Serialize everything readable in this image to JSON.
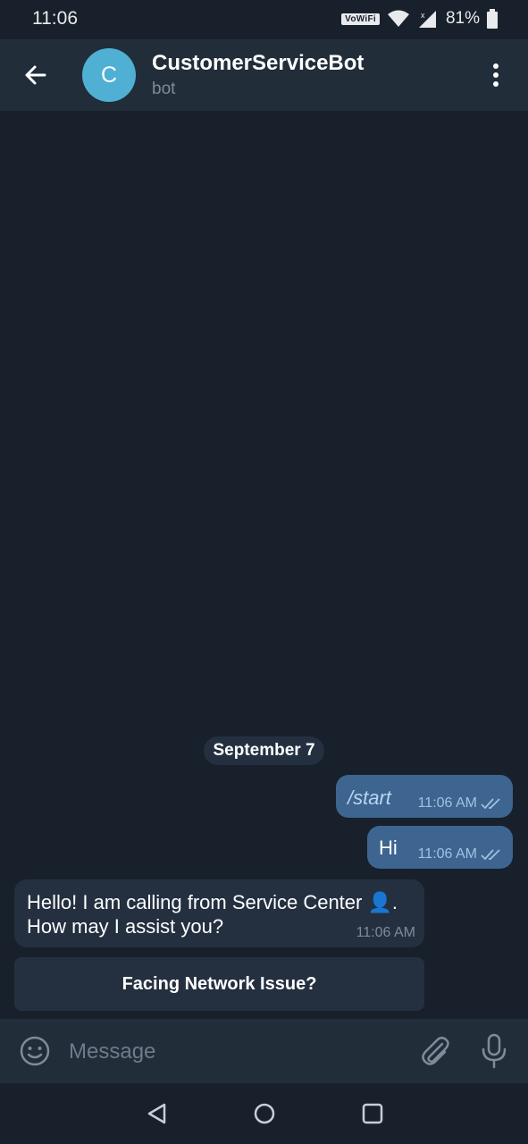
{
  "status": {
    "time": "11:06",
    "vowifi": "VoWiFi",
    "battery": "81%"
  },
  "header": {
    "avatar_letter": "C",
    "title": "CustomerServiceBot",
    "subtitle": "bot"
  },
  "chat": {
    "date": "September 7",
    "outgoing": [
      {
        "text": "/start",
        "time": "11:06 AM"
      },
      {
        "text": "Hi",
        "time": "11:06 AM"
      }
    ],
    "incoming": {
      "line1": "Hello! I am calling from Service Center 👤.",
      "line2": "How may I assist you?",
      "time": "11:06 AM"
    },
    "keyboard_button": "Facing Network Issue?"
  },
  "composer": {
    "placeholder": "Message"
  },
  "colors": {
    "background": "#18202b",
    "appbar": "#222d3a",
    "outgoing_bubble": "#3d6590",
    "incoming_bubble": "#243040",
    "avatar": "#4fb0d3"
  }
}
